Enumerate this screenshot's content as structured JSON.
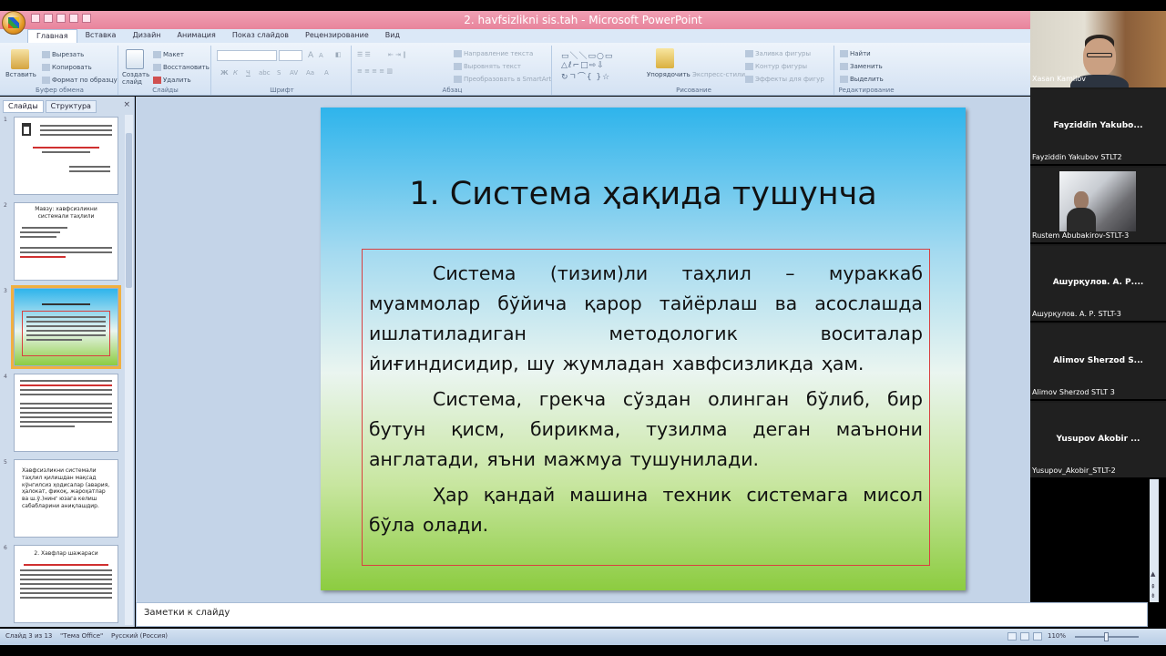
{
  "window": {
    "title": "2. havfsizlikni sis.tah - Microsoft PowerPoint"
  },
  "ribbon": {
    "tabs": [
      "Главная",
      "Вставка",
      "Дизайн",
      "Анимация",
      "Показ слайдов",
      "Рецензирование",
      "Вид"
    ],
    "active_tab": "Главная",
    "clipboard": {
      "paste": "Вставить",
      "cut": "Вырезать",
      "copy": "Копировать",
      "format_painter": "Формат по образцу",
      "label": "Буфер обмена"
    },
    "slides_group": {
      "new_slide": "Создать слайд",
      "layout": "Макет",
      "reset": "Восстановить",
      "delete": "Удалить",
      "label": "Слайды"
    },
    "font_group": {
      "label": "Шрифт"
    },
    "paragraph_group": {
      "text_direction": "Направление текста",
      "align_text": "Выровнять текст",
      "smartart": "Преобразовать в SmartArt",
      "label": "Абзац"
    },
    "drawing_group": {
      "arrange": "Упорядочить",
      "quick_styles": "Экспресс-стили",
      "shape_fill": "Заливка фигуры",
      "shape_outline": "Контур фигуры",
      "shape_effects": "Эффекты для фигур",
      "label": "Рисование"
    },
    "editing_group": {
      "find": "Найти",
      "replace": "Заменить",
      "select": "Выделить",
      "label": "Редактирование"
    }
  },
  "slides_panel": {
    "tabs": [
      "Слайды",
      "Структура"
    ],
    "close": "×",
    "thumbs": [
      {
        "num": "1"
      },
      {
        "num": "2",
        "text": "Мавзу: хавфсизликни системали таҳлили"
      },
      {
        "num": "3"
      },
      {
        "num": "4"
      },
      {
        "num": "5",
        "text": "Хавфсизликни системали таҳлил қилишдан мақсад кўнгилсиз ҳодисалар (авария, ҳалокат, фикоқ, жароҳатлар ва ш.ў.)нинг юзага келиш сабабларини аниқлашдир."
      },
      {
        "num": "6",
        "text": "2. Хавфлар шажараси"
      }
    ]
  },
  "slide": {
    "title": "1. Система ҳақида тушунча",
    "paragraphs": [
      "Система (тизим)ли таҳлил – мураккаб муаммолар бўйича қарор тайёрлаш ва асослашда ишлатиладиган методологик воситалар йиғиндисидир, шу жумладан хавфсизликда ҳам.",
      "Система, грекча сўздан олинган бўлиб, бир бутун қисм, бирикма, тузилма деган маънони англатади, яъни мажмуа тушунилади.",
      "Ҳар қандай машина техник системага мисол бўла олади."
    ]
  },
  "notes": {
    "placeholder": "Заметки к слайду"
  },
  "status": {
    "slide_of": "Слайд 3 из 13",
    "theme": "\"Тема Office\"",
    "language": "Русский (Россия)",
    "zoom": "110%"
  },
  "participants": [
    {
      "name": "Xasan Kamilov",
      "video": true
    },
    {
      "name": "Fayziddin Yakubov STLT2",
      "title": "Fayziddin Yakubo..."
    },
    {
      "name": "Rustem Abubakirov-STLT-3",
      "video": true
    },
    {
      "name": "Ашурқулов. А. Р.  STLT-3",
      "title": "Ашурқулов. А. Р...."
    },
    {
      "name": "Alimov Sherzod STLT 3",
      "title": "Alimov Sherzod S..."
    },
    {
      "name": "Yusupov_Akobir_STLT-2",
      "title": "Yusupov Akobir ..."
    }
  ]
}
